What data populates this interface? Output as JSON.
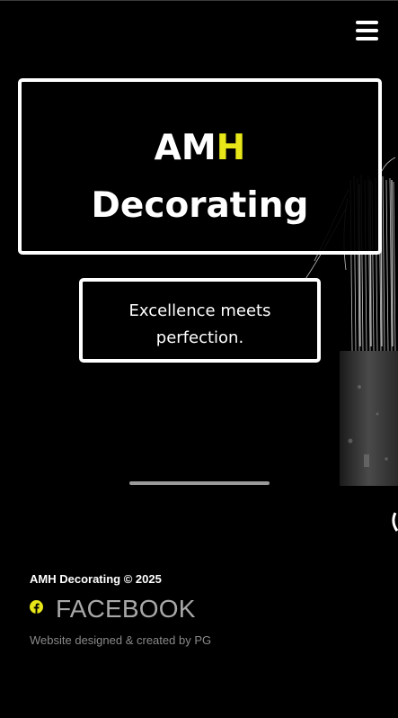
{
  "header": {
    "menu_icon": "hamburger-menu-icon"
  },
  "hero": {
    "title_part1": "AM",
    "title_accent": "H",
    "title_line2": "Decorating",
    "tagline_line1": "Excellence meets",
    "tagline_line2": "perfection."
  },
  "footer": {
    "copyright": "AMH Decorating © 2025",
    "facebook_label": "FACEBOOK",
    "facebook_icon": "facebook-icon",
    "credit": "Website designed & created by PG"
  },
  "colors": {
    "background": "#000000",
    "accent": "#e6e619",
    "border": "#ffffff",
    "muted_text": "#a8a8a8"
  }
}
